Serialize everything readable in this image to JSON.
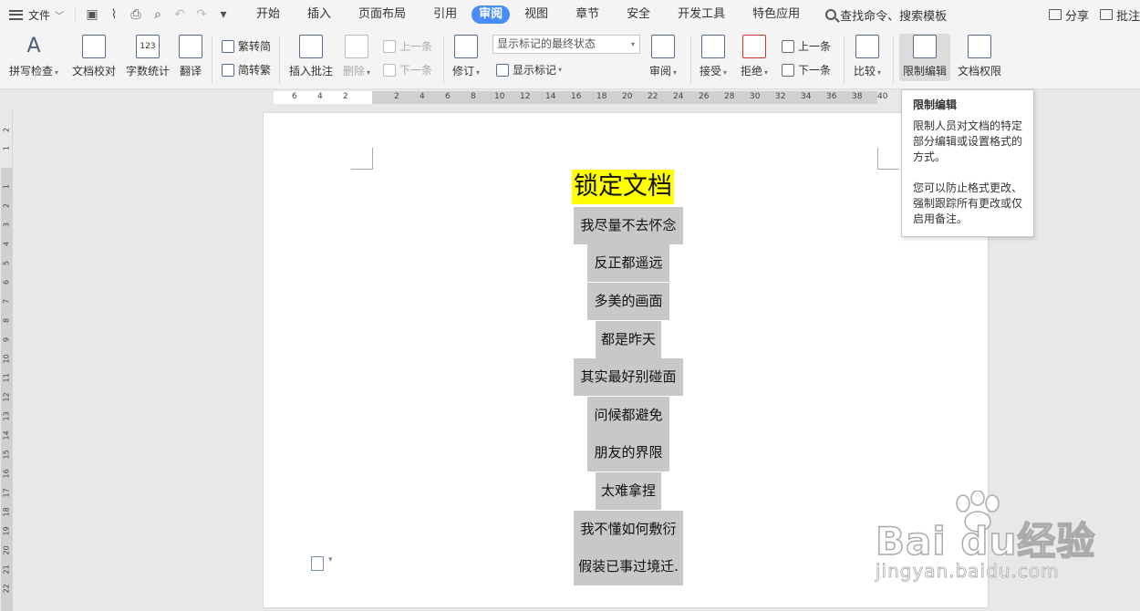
{
  "menubar": {
    "file_label": "文件",
    "tabs": [
      "开始",
      "插入",
      "页面布局",
      "引用",
      "审阅",
      "视图",
      "章节",
      "安全",
      "开发工具",
      "特色应用"
    ],
    "active_tab": "审阅",
    "search_label": "查找命令、搜索模板",
    "share_label": "分享",
    "comment_label": "批注"
  },
  "ribbon": {
    "spellcheck": "拼写检查",
    "doc_proof": "文档校对",
    "word_count": "字数统计",
    "translate": "翻译",
    "trad": "繁转简",
    "simp": "简转繁",
    "insert_comment": "插入批注",
    "delete": "删除",
    "prev_comment": "上一条",
    "next_comment": "下一条",
    "revise": "修订",
    "display_combo": "显示标记的最终状态",
    "show_markup": "显示标记",
    "review": "审阅",
    "accept": "接受",
    "reject": "拒绝",
    "prev_change": "上一条",
    "next_change": "下一条",
    "compare": "比较",
    "restrict_edit": "限制编辑",
    "doc_rights": "文档权限"
  },
  "ruler": {
    "h_ticks": [
      "6",
      "4",
      "2",
      "2",
      "4",
      "6",
      "8",
      "10",
      "12",
      "14",
      "16",
      "18",
      "20",
      "22",
      "24",
      "26",
      "28",
      "30",
      "32",
      "34",
      "36",
      "38",
      "40"
    ],
    "v_ticks": [
      "2",
      "1",
      "1",
      "2",
      "3",
      "4",
      "5",
      "6",
      "7",
      "8",
      "9",
      "10",
      "11",
      "12",
      "13",
      "14",
      "15",
      "16",
      "17",
      "18",
      "19",
      "20",
      "21",
      "22"
    ]
  },
  "document": {
    "title": "锁定文档",
    "lines": [
      "我尽量不去怀念",
      "反正都遥远",
      "多美的画面",
      "都是昨天",
      "其实最好别碰面",
      "问候都避免",
      "朋友的界限",
      "太难拿捏",
      "我不懂如何敷衍",
      "假装已事过境迁."
    ]
  },
  "tooltip": {
    "title": "限制编辑",
    "para1": "限制人员对文档的特定部分编辑或设置格式的方式。",
    "para2": "您可以防止格式更改、强制跟踪所有更改或仅启用备注。"
  },
  "watermark": {
    "brand": "Bai du经验",
    "url": "jingyan.baidu.com"
  }
}
